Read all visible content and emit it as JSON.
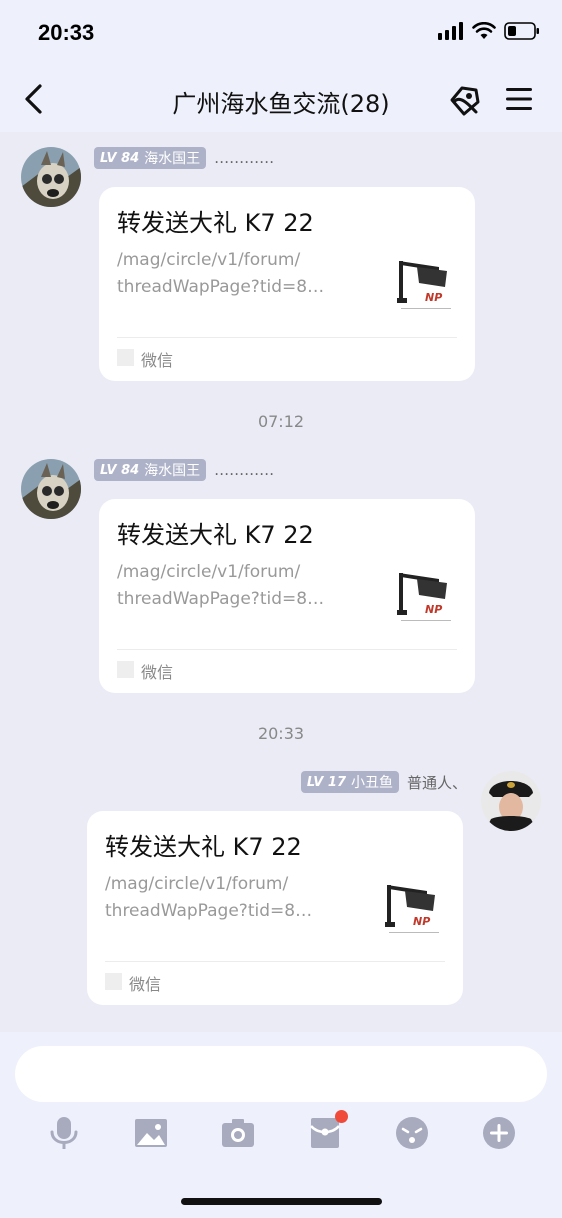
{
  "status_bar": {
    "time": "20:33",
    "icons": [
      "signal-icon",
      "wifi-icon",
      "battery-icon"
    ]
  },
  "nav": {
    "title": "广州海水鱼交流(28)",
    "icons": [
      "back-icon",
      "share-icon",
      "menu-icon"
    ]
  },
  "messages": [
    {
      "sender_level": "LV 84",
      "sender_name": "海水国王",
      "sender_extra": "…………",
      "card": {
        "title": "转发送大礼 K7 22",
        "desc_line1": "/mag/circle/v1/forum/",
        "desc_line2": "threadWapPage?tid=8…",
        "source": "微信"
      }
    },
    {
      "sender_level": "LV 84",
      "sender_name": "海水国王",
      "sender_extra": "…………",
      "card": {
        "title": "转发送大礼 K7 22",
        "desc_line1": "/mag/circle/v1/forum/",
        "desc_line2": "threadWapPage?tid=8…",
        "source": "微信"
      }
    },
    {
      "sender_level": "LV 17",
      "sender_name": "小丑鱼",
      "sender_extra": "普通人、",
      "card": {
        "title": "转发送大礼 K7 22",
        "desc_line1": "/mag/circle/v1/forum/",
        "desc_line2": "threadWapPage?tid=8…",
        "source": "微信"
      }
    }
  ],
  "time_separators": [
    "07:12",
    "20:33"
  ],
  "input": {
    "placeholder": ""
  },
  "toolbar": {
    "icons": [
      "microphone-icon",
      "image-icon",
      "camera-icon",
      "red-envelope-icon",
      "emoji-icon",
      "plus-icon"
    ],
    "red_envelope_has_badge": true
  },
  "colors": {
    "background": "#eaebf5",
    "level_badge": "#aeb2c8",
    "notification_dot": "#f04a3a"
  }
}
